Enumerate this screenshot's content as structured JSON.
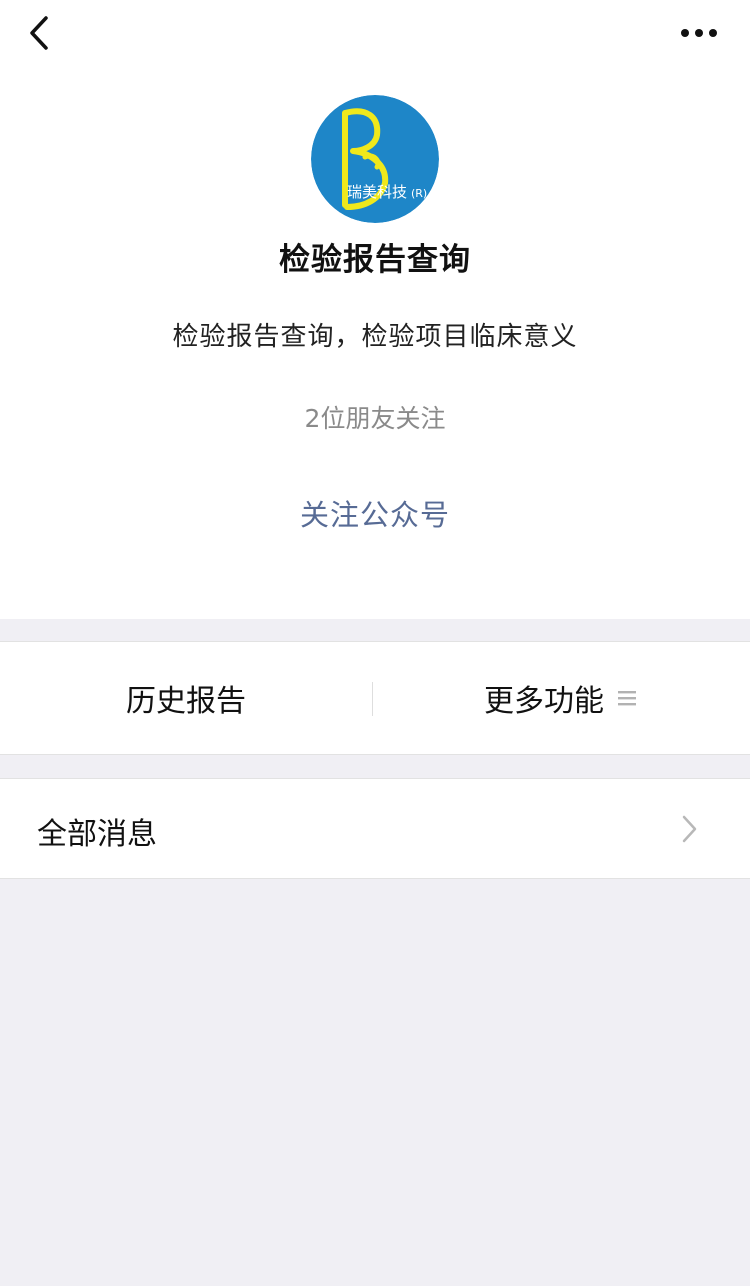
{
  "header": {
    "back_icon": "chevron-left-icon",
    "more_icon": "more-dots-icon"
  },
  "profile": {
    "avatar": {
      "text": "瑞美科技",
      "mark": "(R)",
      "background_color": "#1e86c8",
      "accent_color": "#f0e81c"
    },
    "name": "检验报告查询",
    "description": "检验报告查询，检验项目临床意义",
    "followers_text": "2位朋友关注",
    "follow_button_label": "关注公众号",
    "link_color": "#576b95"
  },
  "menu": {
    "items": [
      {
        "label": "历史报告"
      },
      {
        "label": "更多功能",
        "icon": "menu-lines-icon"
      }
    ]
  },
  "messages": {
    "label": "全部消息",
    "icon": "chevron-right-icon"
  }
}
